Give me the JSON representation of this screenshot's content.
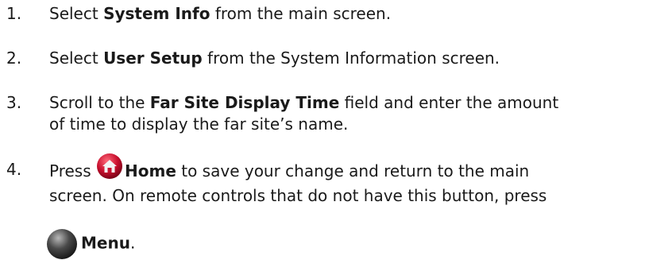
{
  "steps": [
    {
      "number": "1.",
      "pre": "Select ",
      "bold": "System Info",
      "post": " from the main screen."
    },
    {
      "number": "2.",
      "pre": "Select ",
      "bold": "User Setup",
      "post": " from the System Information screen."
    },
    {
      "number": "3.",
      "pre": "Scroll to the ",
      "bold": "Far Site Display Time",
      "post_line1": " field and enter the amount",
      "post_line2": "of time to display the far site’s name."
    },
    {
      "number": "4.",
      "pre": "Press ",
      "home_icon": "home-button-icon",
      "bold": "Home",
      "post_line1": " to save your change and return to the main",
      "line2": "screen. On remote controls that do not have this button, press",
      "menu_icon": "menu-button-icon",
      "bold2": "Menu",
      "post2": "."
    }
  ],
  "colors": {
    "text": "#1a1a1a",
    "home_icon_red": "#c8102e",
    "menu_icon_gray": "#3a3a3a"
  }
}
